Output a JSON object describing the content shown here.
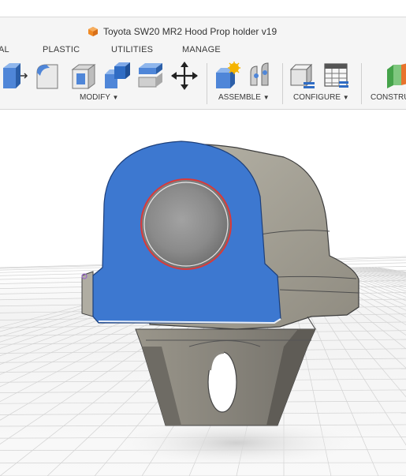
{
  "window": {
    "title": "Toyota SW20 MR2 Hood Prop holder v19"
  },
  "tabs": [
    {
      "label": "AL"
    },
    {
      "label": "PLASTIC"
    },
    {
      "label": "UTILITIES"
    },
    {
      "label": "MANAGE"
    }
  ],
  "toolbar": {
    "groups": [
      {
        "label": "MODIFY"
      },
      {
        "label": "ASSEMBLE"
      },
      {
        "label": "CONFIGURE"
      },
      {
        "label": "CONSTRU"
      }
    ],
    "tools": [
      {
        "icon": "press-pull-icon"
      },
      {
        "icon": "fillet-icon"
      },
      {
        "icon": "shell-icon"
      },
      {
        "icon": "combine-icon"
      },
      {
        "icon": "replace-face-icon"
      },
      {
        "icon": "move-copy-icon"
      },
      {
        "icon": "new-component-icon"
      },
      {
        "icon": "joint-icon"
      },
      {
        "icon": "parameters-icon"
      },
      {
        "icon": "configure-table-icon"
      },
      {
        "icon": "offset-plane-icon"
      }
    ]
  },
  "colors": {
    "selected_face": "#3d78d0",
    "body": "#9f9b8e",
    "hole_edge": "#d93a3a",
    "app_icon": "#f08a24"
  }
}
